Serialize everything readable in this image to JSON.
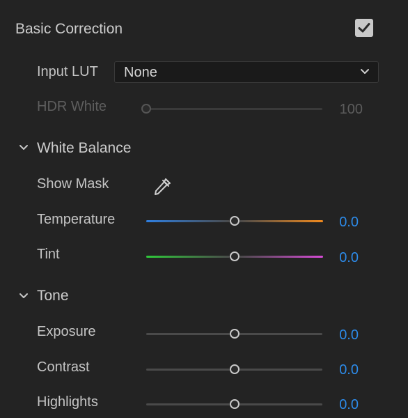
{
  "header": {
    "title": "Basic Correction",
    "enabled": true
  },
  "input_lut": {
    "label": "Input LUT",
    "value": "None"
  },
  "hdr_white": {
    "label": "HDR White",
    "value": "100",
    "slider_fraction": 0.0
  },
  "white_balance": {
    "title": "White Balance",
    "show_mask_label": "Show Mask",
    "temperature": {
      "label": "Temperature",
      "value": "0.0",
      "slider_fraction": 0.5,
      "color_left": "#2f7fe0",
      "color_right": "#f08a1e"
    },
    "tint": {
      "label": "Tint",
      "value": "0.0",
      "slider_fraction": 0.5,
      "color_left": "#2fc93a",
      "color_right": "#d64bd6"
    }
  },
  "tone": {
    "title": "Tone",
    "exposure": {
      "label": "Exposure",
      "value": "0.0",
      "slider_fraction": 0.5
    },
    "contrast": {
      "label": "Contrast",
      "value": "0.0",
      "slider_fraction": 0.5
    },
    "highlights": {
      "label": "Highlights",
      "value": "0.0",
      "slider_fraction": 0.5
    }
  },
  "colors": {
    "background": "#232323",
    "accent_value": "#2d8ceb",
    "neutral_track": "#4a4a4a"
  }
}
